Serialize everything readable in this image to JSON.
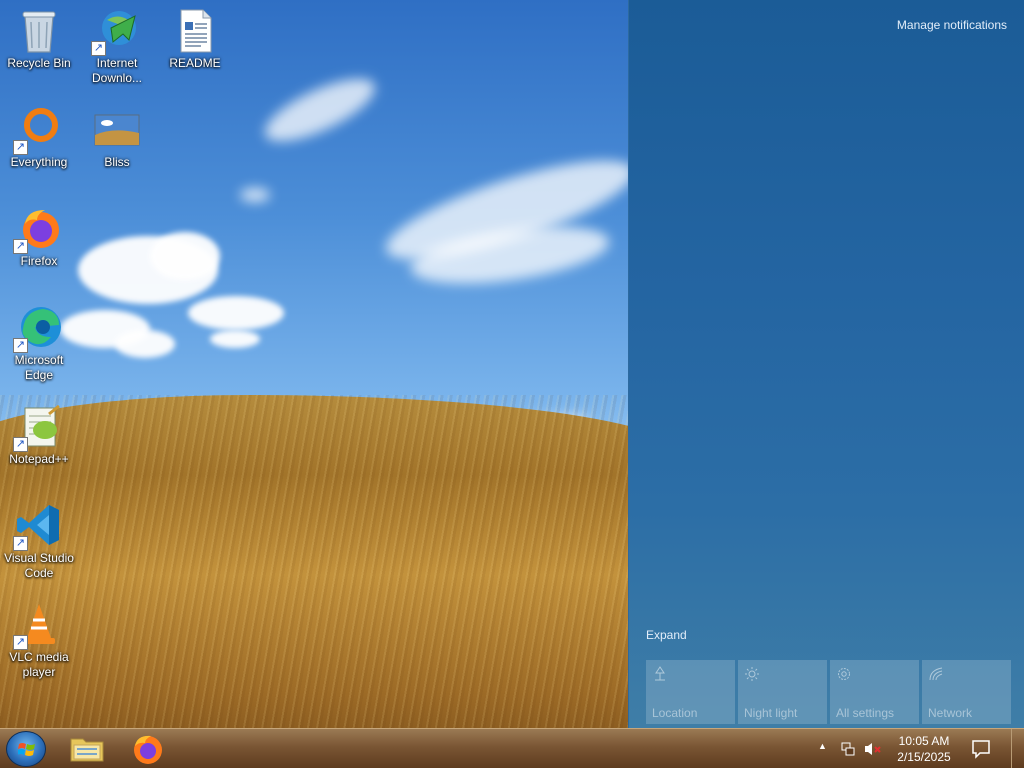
{
  "desktop": {
    "icons": [
      {
        "label": "Recycle Bin",
        "icon": "recycle-bin-icon"
      },
      {
        "label": "Internet Downlo...",
        "icon": "internet-download-manager-icon"
      },
      {
        "label": "README",
        "icon": "document-icon"
      },
      {
        "label": "Everything",
        "icon": "everything-search-icon"
      },
      {
        "label": "Bliss",
        "icon": "image-icon"
      },
      {
        "label": "Firefox",
        "icon": "firefox-icon"
      },
      {
        "label": "Microsoft Edge",
        "icon": "edge-icon"
      },
      {
        "label": "Notepad++",
        "icon": "notepadpp-icon"
      },
      {
        "label": "Visual Studio Code",
        "icon": "vscode-icon"
      },
      {
        "label": "VLC media player",
        "icon": "vlc-icon"
      }
    ]
  },
  "action_center": {
    "manage_notifications": "Manage notifications",
    "expand": "Expand",
    "quick_actions": [
      {
        "label": "Location",
        "icon": "location-icon"
      },
      {
        "label": "Night light",
        "icon": "night-light-icon"
      },
      {
        "label": "All settings",
        "icon": "settings-gear-icon"
      },
      {
        "label": "Network",
        "icon": "network-icon"
      }
    ]
  },
  "taskbar": {
    "pinned": [
      {
        "name": "File Explorer",
        "icon": "file-explorer-icon"
      },
      {
        "name": "Firefox",
        "icon": "firefox-icon"
      }
    ],
    "clock": {
      "time": "10:05 AM",
      "date": "2/15/2025"
    }
  },
  "colors": {
    "action_center_bg": "#1b5c97",
    "taskbar_bg": "#7a5634",
    "tile_bg": "#4d82b1"
  }
}
